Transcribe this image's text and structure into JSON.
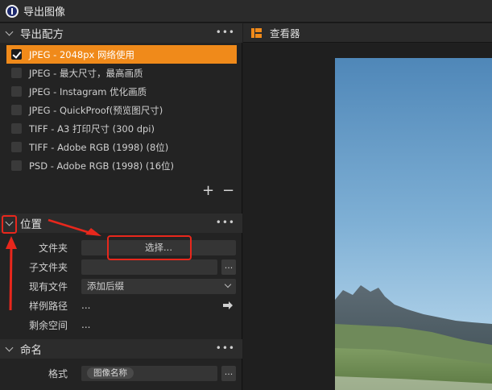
{
  "window": {
    "title": "导出图像"
  },
  "recipes": {
    "title": "导出配方",
    "items": [
      {
        "label": "JPEG - 2048px 网络使用",
        "selected": true
      },
      {
        "label": "JPEG - 最大尺寸，最高画质",
        "selected": false
      },
      {
        "label": "JPEG - Instagram 优化画质",
        "selected": false
      },
      {
        "label": "JPEG - QuickProof(预览图尺寸)",
        "selected": false
      },
      {
        "label": "TIFF - A3 打印尺寸 (300 dpi)",
        "selected": false
      },
      {
        "label": "TIFF - Adobe RGB (1998) (8位)",
        "selected": false
      },
      {
        "label": "PSD - Adobe RGB (1998) (16位)",
        "selected": false
      }
    ],
    "add_label": "+",
    "remove_label": "−"
  },
  "location": {
    "title": "位置",
    "folder_label": "文件夹",
    "choose_button": "选择...",
    "subfolder_label": "子文件夹",
    "subfolder_button": "...",
    "existing_label": "现有文件",
    "existing_value": "添加后缀",
    "sample_path_label": "样例路径",
    "sample_path_value": "...",
    "free_space_label": "剩余空间",
    "free_space_value": "..."
  },
  "naming": {
    "title": "命名",
    "format_label": "格式",
    "format_token": "图像名称",
    "format_button": "..."
  },
  "viewer": {
    "title": "查看器"
  },
  "colors": {
    "accent": "#f08a1a",
    "annotation": "#e8271c"
  }
}
